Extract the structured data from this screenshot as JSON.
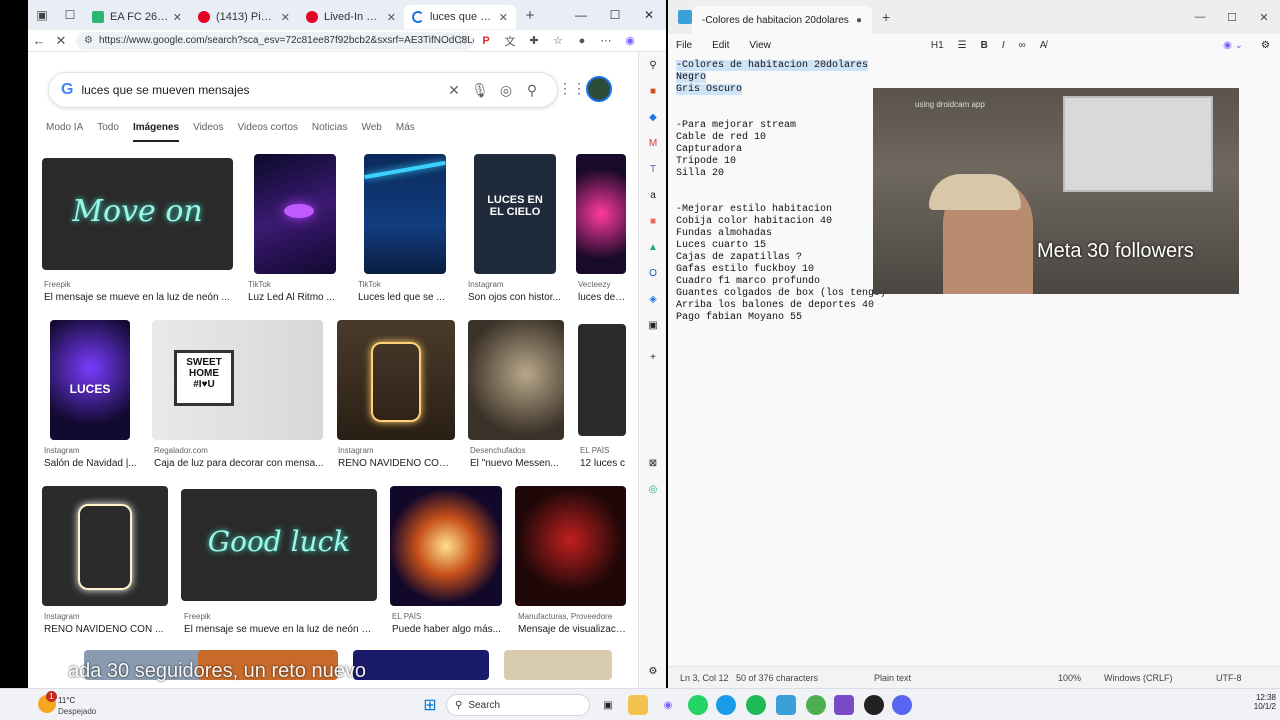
{
  "browser": {
    "tabs": [
      {
        "title": "EA FC 26 Squad Bu",
        "color": "#2bb673"
      },
      {
        "title": "(1413) Pinterest",
        "color": "#e60023"
      },
      {
        "title": "Lived-In Gamer",
        "color": "#e60023"
      },
      {
        "title": "luces que se mueve",
        "color": "#1a73e8"
      }
    ],
    "url": "https://www.google.com/search?sca_esv=72c81ee87f92bcb2&sxsrf=AE3TifNOdC8Lg...",
    "query": "luces que se mueven mensajes",
    "filters": [
      "Modo IA",
      "Todo",
      "Imágenes",
      "Videos",
      "Videos cortos",
      "Noticias",
      "Web",
      "Más"
    ],
    "selected_filter": "Imágenes",
    "results": [
      {
        "src": "Freepik",
        "title": "El mensaje se mueve en la luz de neón ...",
        "overlay": "Move on"
      },
      {
        "src": "TikTok",
        "title": "Luz Led Al Ritmo ..."
      },
      {
        "src": "TikTok",
        "title": "Luces led que se ..."
      },
      {
        "src": "Instagram",
        "title": "Son ojos con histor...",
        "overlay": "LUCES EN EL CIELO"
      },
      {
        "src": "Vecteezy",
        "title": "luces de ne"
      },
      {
        "src": "Instagram",
        "title": "Salón de Navidad |...",
        "overlay": "LUCES"
      },
      {
        "src": "Regalador.com",
        "title": "Caja de luz para decorar con mensa...",
        "overlay": "SWEET HOME #I♥U"
      },
      {
        "src": "Instagram",
        "title": "RENO NAVIDEÑO CON..."
      },
      {
        "src": "Desenchufados",
        "title": "El \"nuevo Messen..."
      },
      {
        "src": "EL PAÍS",
        "title": "12 luces c"
      },
      {
        "src": "Instagram",
        "title": "RENO NAVIDEÑO CON ..."
      },
      {
        "src": "Freepik",
        "title": "El mensaje se mueve en la luz de neón e...",
        "overlay": "Good luck"
      },
      {
        "src": "EL PAÍS",
        "title": "Puede haber algo más..."
      },
      {
        "src": "Manufacturas, Proveedore",
        "title": "Mensaje de visualización"
      }
    ],
    "subtitle": "ada 30 seguidores, un reto nuevo"
  },
  "notepad": {
    "tab_title": "-Colores de habitacion 20dolares",
    "menu": [
      "File",
      "Edit",
      "View"
    ],
    "heading_tool": "H1",
    "lines": [
      "-Colores de habitacion 20dolares",
      "Negro",
      "Gris Oscuro",
      "",
      "",
      "-Para mejorar stream",
      "Cable de red 10",
      "Capturadora",
      "Tripode 10",
      "Silla 20",
      "",
      "",
      "-Mejorar estilo habitacion",
      "Cobija color habitacion 40",
      "Fundas almohadas",
      "Luces cuarto 15",
      "Cajas de zapatillas ?",
      "Gafas estilo fuckboy 10",
      "Cuadro f1 marco profundo",
      "Guantes colgados de box (los tengo)",
      "Arriba los balones de deportes 40",
      "Pago fabian Moyano 55"
    ],
    "webcam_text": "Meta 30 followers",
    "webcam_watermark": "using droidcam app",
    "status": {
      "position": "Ln 3, Col 12",
      "chars": "50 of 376 characters",
      "format": "Plain text",
      "zoom": "100%",
      "eol": "Windows (CRLF)",
      "encoding": "UTF-8"
    }
  },
  "taskbar": {
    "weather_temp": "11°C",
    "weather_desc": "Despejado",
    "weather_badge": "1",
    "search": "Search",
    "time": "12:38",
    "date": "10/1/2"
  }
}
